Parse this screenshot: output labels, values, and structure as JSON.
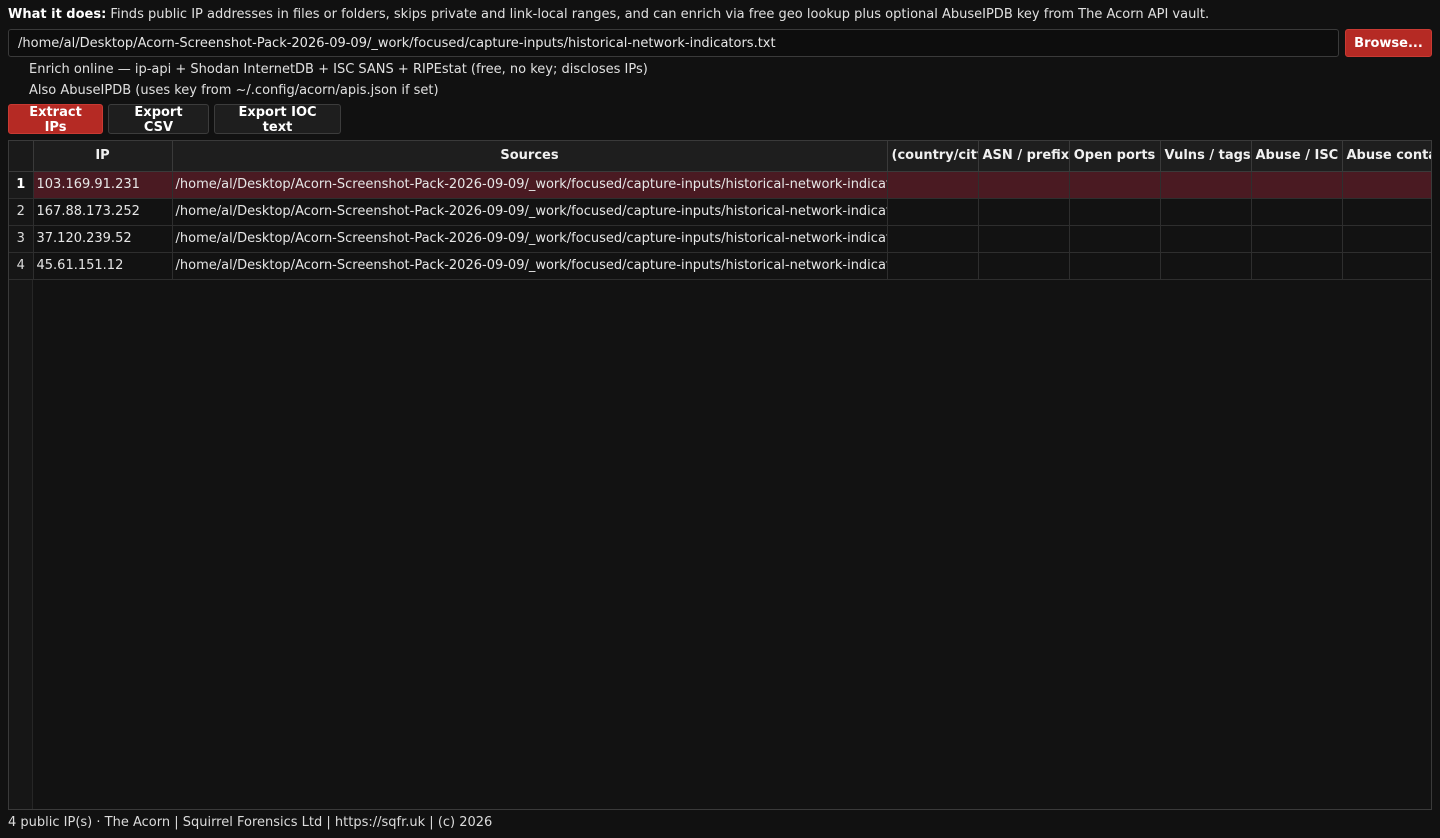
{
  "description": {
    "label": "What it does:",
    "text": " Finds public IP addresses in files or folders, skips private and link-local ranges, and can enrich via free geo lookup plus optional AbuseIPDB key from The Acorn API vault."
  },
  "path_input": {
    "value": "/home/al/Desktop/Acorn-Screenshot-Pack-2026-09-09/_work/focused/capture-inputs/historical-network-indicators.txt"
  },
  "browse_label": "Browse...",
  "options": {
    "enrich_online": "Enrich online — ip-api + Shodan InternetDB + ISC SANS + RIPEstat (free, no key; discloses IPs)",
    "abuseipdb": "Also AbuseIPDB (uses key from ~/.config/acorn/apis.json if set)"
  },
  "actions": {
    "extract": "Extract IPs",
    "export_csv": "Export CSV",
    "export_ioc": "Export IOC text"
  },
  "table": {
    "columns": [
      "IP",
      "Sources",
      "(country/city)",
      "ASN / prefix",
      "Open ports",
      "Vulns / tags",
      "Abuse / ISC",
      "Abuse contact"
    ],
    "rows": [
      {
        "n": "1",
        "ip": "103.169.91.231",
        "source": "/home/al/Desktop/Acorn-Screenshot-Pack-2026-09-09/_work/focused/capture-inputs/historical-network-indicators.txt"
      },
      {
        "n": "2",
        "ip": "167.88.173.252",
        "source": "/home/al/Desktop/Acorn-Screenshot-Pack-2026-09-09/_work/focused/capture-inputs/historical-network-indicators.txt"
      },
      {
        "n": "3",
        "ip": "37.120.239.52",
        "source": "/home/al/Desktop/Acorn-Screenshot-Pack-2026-09-09/_work/focused/capture-inputs/historical-network-indicators.txt"
      },
      {
        "n": "4",
        "ip": "45.61.151.12",
        "source": "/home/al/Desktop/Acorn-Screenshot-Pack-2026-09-09/_work/focused/capture-inputs/historical-network-indicators.txt"
      }
    ]
  },
  "status": "4 public IP(s) · The Acorn  |  Squirrel Forensics Ltd  |  https://sqfr.uk  |  (c) 2026",
  "colors": {
    "accent": "#b52a24",
    "selected_row": "#4a1a22",
    "background": "#111111"
  }
}
